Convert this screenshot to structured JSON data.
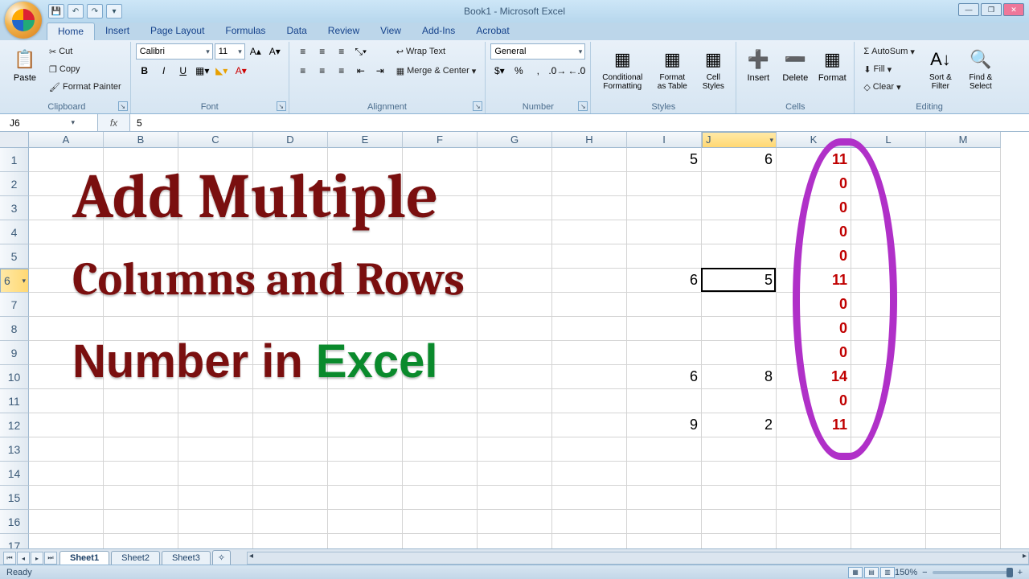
{
  "app": {
    "title": "Book1 - Microsoft Excel"
  },
  "qat": {
    "save": "💾",
    "undo": "↶",
    "redo": "↷"
  },
  "tabs": [
    "Home",
    "Insert",
    "Page Layout",
    "Formulas",
    "Data",
    "Review",
    "View",
    "Add-Ins",
    "Acrobat"
  ],
  "active_tab": 0,
  "ribbon": {
    "clipboard": {
      "label": "Clipboard",
      "paste": "Paste",
      "cut": "Cut",
      "copy": "Copy",
      "fp": "Format Painter"
    },
    "font": {
      "label": "Font",
      "name": "Calibri",
      "size": "11",
      "b": "B",
      "i": "I",
      "u": "U"
    },
    "alignment": {
      "label": "Alignment",
      "wrap": "Wrap Text",
      "merge": "Merge & Center"
    },
    "number": {
      "label": "Number",
      "format": "General"
    },
    "styles": {
      "label": "Styles",
      "cf": "Conditional Formatting",
      "fat": "Format as Table",
      "cs": "Cell Styles"
    },
    "cells": {
      "label": "Cells",
      "ins": "Insert",
      "del": "Delete",
      "fmt": "Format"
    },
    "editing": {
      "label": "Editing",
      "sum": "AutoSum",
      "fill": "Fill",
      "clear": "Clear",
      "sort": "Sort & Filter",
      "find": "Find & Select"
    }
  },
  "namebox": "J6",
  "formula": "5",
  "columns": [
    "A",
    "B",
    "C",
    "D",
    "E",
    "F",
    "G",
    "H",
    "I",
    "J",
    "K",
    "L",
    "M"
  ],
  "rows": [
    "1",
    "2",
    "3",
    "4",
    "5",
    "6",
    "7",
    "8",
    "9",
    "10",
    "11",
    "12",
    "13",
    "14",
    "15",
    "16",
    "17"
  ],
  "active_col": "J",
  "active_row": "6",
  "cell_data": {
    "1": {
      "I": "5",
      "J": "6",
      "K": "11"
    },
    "2": {
      "K": "0"
    },
    "3": {
      "K": "0"
    },
    "4": {
      "K": "0"
    },
    "5": {
      "K": "0"
    },
    "6": {
      "I": "6",
      "J": "5",
      "K": "11"
    },
    "7": {
      "K": "0"
    },
    "8": {
      "K": "0"
    },
    "9": {
      "K": "0"
    },
    "10": {
      "I": "6",
      "J": "8",
      "K": "14"
    },
    "11": {
      "K": "0"
    },
    "12": {
      "I": "9",
      "J": "2",
      "K": "11"
    }
  },
  "overlay": {
    "l1": "Add Multiple",
    "l2": "Columns and Rows",
    "l3a": "Number in ",
    "l3b": "Excel"
  },
  "sheets": [
    "Sheet1",
    "Sheet2",
    "Sheet3"
  ],
  "status": {
    "ready": "Ready",
    "zoom": "150%"
  }
}
